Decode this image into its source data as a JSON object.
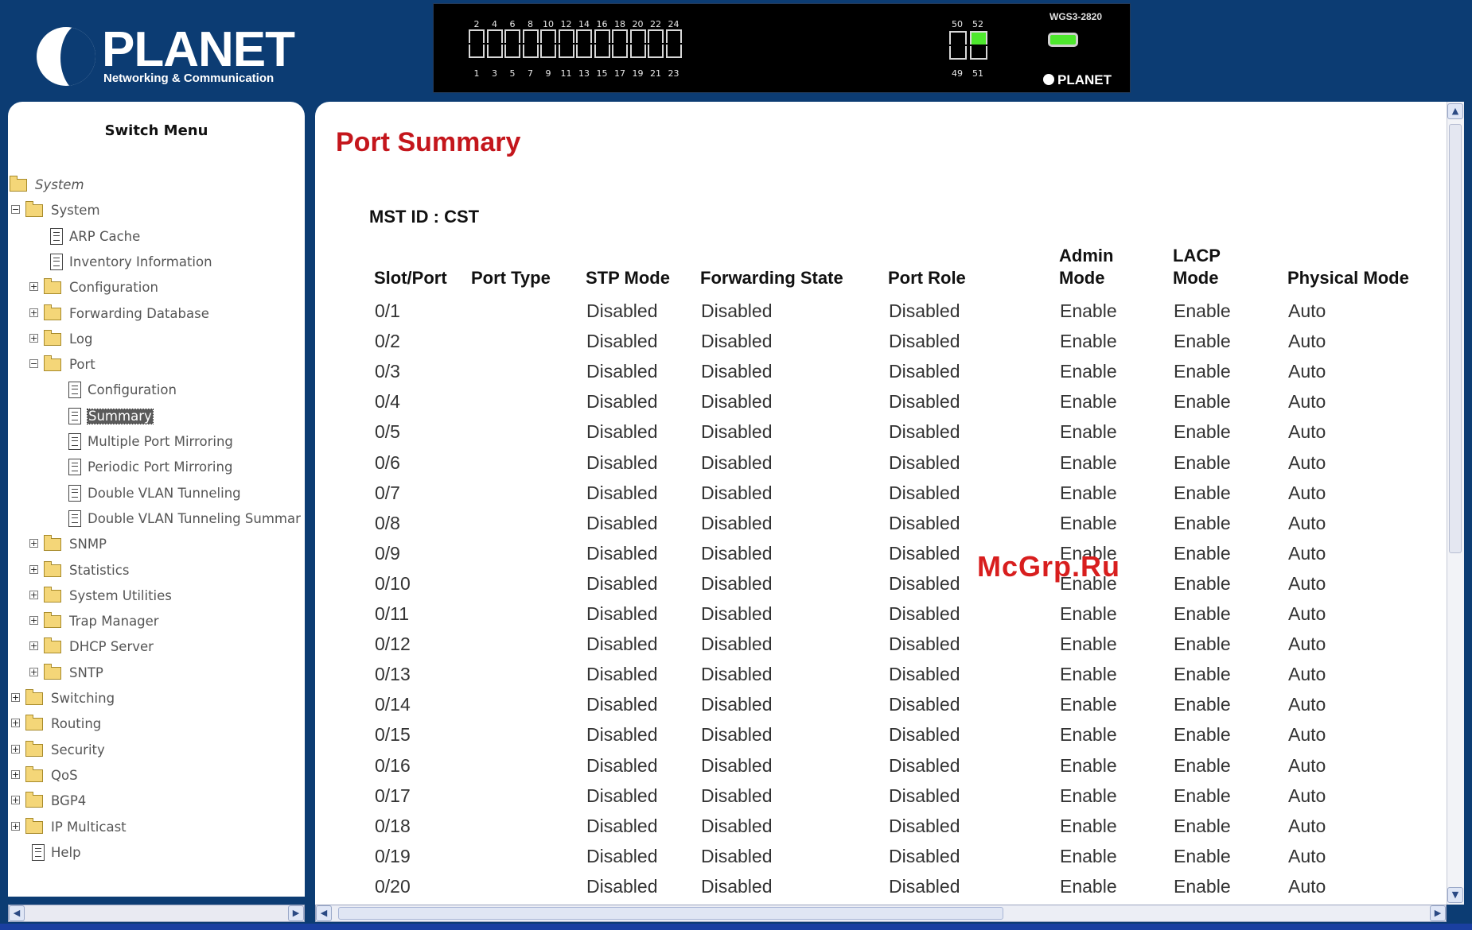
{
  "brand": {
    "name": "PLANET",
    "tagline": "Networking & Communication"
  },
  "device": {
    "model": "WGS3-2820",
    "brand": "PLANET",
    "top_port_labels": [
      "2",
      "4",
      "6",
      "8",
      "10",
      "12",
      "14",
      "16",
      "18",
      "20",
      "22",
      "24"
    ],
    "bottom_port_labels": [
      "1",
      "3",
      "5",
      "7",
      "9",
      "11",
      "13",
      "15",
      "17",
      "19",
      "21",
      "23"
    ],
    "sfp_top_labels": [
      "50",
      "52"
    ],
    "sfp_bottom_labels": [
      "49",
      "51"
    ],
    "status_led_color": "#4ee82e"
  },
  "sidebar": {
    "title": "Switch Menu",
    "items": [
      {
        "label": "System",
        "type": "folder",
        "level": 0,
        "expander": "",
        "root": true
      },
      {
        "label": "System",
        "type": "folder",
        "level": 1,
        "expander": "−"
      },
      {
        "label": "ARP Cache",
        "type": "page",
        "level": 2
      },
      {
        "label": "Inventory Information",
        "type": "page",
        "level": 2
      },
      {
        "label": "Configuration",
        "type": "folder",
        "level": 2,
        "expander": "+"
      },
      {
        "label": "Forwarding Database",
        "type": "folder",
        "level": 2,
        "expander": "+"
      },
      {
        "label": "Log",
        "type": "folder",
        "level": 2,
        "expander": "+"
      },
      {
        "label": "Port",
        "type": "folder",
        "level": 2,
        "expander": "−"
      },
      {
        "label": "Configuration",
        "type": "page",
        "level": 3
      },
      {
        "label": "Summary",
        "type": "page",
        "level": 3,
        "selected": true
      },
      {
        "label": "Multiple Port Mirroring",
        "type": "page",
        "level": 3
      },
      {
        "label": "Periodic Port Mirroring",
        "type": "page",
        "level": 3
      },
      {
        "label": "Double VLAN Tunneling",
        "type": "page",
        "level": 3
      },
      {
        "label": "Double VLAN Tunneling Summar",
        "type": "page",
        "level": 3
      },
      {
        "label": "SNMP",
        "type": "folder",
        "level": 2,
        "expander": "+"
      },
      {
        "label": "Statistics",
        "type": "folder",
        "level": 2,
        "expander": "+"
      },
      {
        "label": "System Utilities",
        "type": "folder",
        "level": 2,
        "expander": "+"
      },
      {
        "label": "Trap Manager",
        "type": "folder",
        "level": 2,
        "expander": "+"
      },
      {
        "label": "DHCP Server",
        "type": "folder",
        "level": 2,
        "expander": "+"
      },
      {
        "label": "SNTP",
        "type": "folder",
        "level": 2,
        "expander": "+"
      },
      {
        "label": "Switching",
        "type": "folder",
        "level": 1,
        "expander": "+"
      },
      {
        "label": "Routing",
        "type": "folder",
        "level": 1,
        "expander": "+"
      },
      {
        "label": "Security",
        "type": "folder",
        "level": 1,
        "expander": "+"
      },
      {
        "label": "QoS",
        "type": "folder",
        "level": 1,
        "expander": "+"
      },
      {
        "label": "BGP4",
        "type": "folder",
        "level": 1,
        "expander": "+"
      },
      {
        "label": "IP Multicast",
        "type": "folder",
        "level": 1,
        "expander": "+"
      },
      {
        "label": "Help",
        "type": "page",
        "level": 1
      }
    ]
  },
  "main": {
    "title": "Port Summary",
    "mst_id": "MST ID : CST",
    "columns": [
      {
        "line1": "",
        "line2": "Slot/Port"
      },
      {
        "line1": "",
        "line2": "Port Type"
      },
      {
        "line1": "",
        "line2": "STP Mode"
      },
      {
        "line1": "",
        "line2": "Forwarding State"
      },
      {
        "line1": "",
        "line2": "Port Role"
      },
      {
        "line1": "Admin",
        "line2": "Mode"
      },
      {
        "line1": "LACP",
        "line2": "Mode"
      },
      {
        "line1": "",
        "line2": "Physical Mode"
      }
    ],
    "rows": [
      [
        "0/1",
        "",
        "Disabled",
        "Disabled",
        "Disabled",
        "Enable",
        "Enable",
        "Auto"
      ],
      [
        "0/2",
        "",
        "Disabled",
        "Disabled",
        "Disabled",
        "Enable",
        "Enable",
        "Auto"
      ],
      [
        "0/3",
        "",
        "Disabled",
        "Disabled",
        "Disabled",
        "Enable",
        "Enable",
        "Auto"
      ],
      [
        "0/4",
        "",
        "Disabled",
        "Disabled",
        "Disabled",
        "Enable",
        "Enable",
        "Auto"
      ],
      [
        "0/5",
        "",
        "Disabled",
        "Disabled",
        "Disabled",
        "Enable",
        "Enable",
        "Auto"
      ],
      [
        "0/6",
        "",
        "Disabled",
        "Disabled",
        "Disabled",
        "Enable",
        "Enable",
        "Auto"
      ],
      [
        "0/7",
        "",
        "Disabled",
        "Disabled",
        "Disabled",
        "Enable",
        "Enable",
        "Auto"
      ],
      [
        "0/8",
        "",
        "Disabled",
        "Disabled",
        "Disabled",
        "Enable",
        "Enable",
        "Auto"
      ],
      [
        "0/9",
        "",
        "Disabled",
        "Disabled",
        "Disabled",
        "Enable",
        "Enable",
        "Auto"
      ],
      [
        "0/10",
        "",
        "Disabled",
        "Disabled",
        "Disabled",
        "Enable",
        "Enable",
        "Auto"
      ],
      [
        "0/11",
        "",
        "Disabled",
        "Disabled",
        "Disabled",
        "Enable",
        "Enable",
        "Auto"
      ],
      [
        "0/12",
        "",
        "Disabled",
        "Disabled",
        "Disabled",
        "Enable",
        "Enable",
        "Auto"
      ],
      [
        "0/13",
        "",
        "Disabled",
        "Disabled",
        "Disabled",
        "Enable",
        "Enable",
        "Auto"
      ],
      [
        "0/14",
        "",
        "Disabled",
        "Disabled",
        "Disabled",
        "Enable",
        "Enable",
        "Auto"
      ],
      [
        "0/15",
        "",
        "Disabled",
        "Disabled",
        "Disabled",
        "Enable",
        "Enable",
        "Auto"
      ],
      [
        "0/16",
        "",
        "Disabled",
        "Disabled",
        "Disabled",
        "Enable",
        "Enable",
        "Auto"
      ],
      [
        "0/17",
        "",
        "Disabled",
        "Disabled",
        "Disabled",
        "Enable",
        "Enable",
        "Auto"
      ],
      [
        "0/18",
        "",
        "Disabled",
        "Disabled",
        "Disabled",
        "Enable",
        "Enable",
        "Auto"
      ],
      [
        "0/19",
        "",
        "Disabled",
        "Disabled",
        "Disabled",
        "Enable",
        "Enable",
        "Auto"
      ],
      [
        "0/20",
        "",
        "Disabled",
        "Disabled",
        "Disabled",
        "Enable",
        "Enable",
        "Auto"
      ]
    ]
  },
  "watermark": "McGrp.Ru"
}
